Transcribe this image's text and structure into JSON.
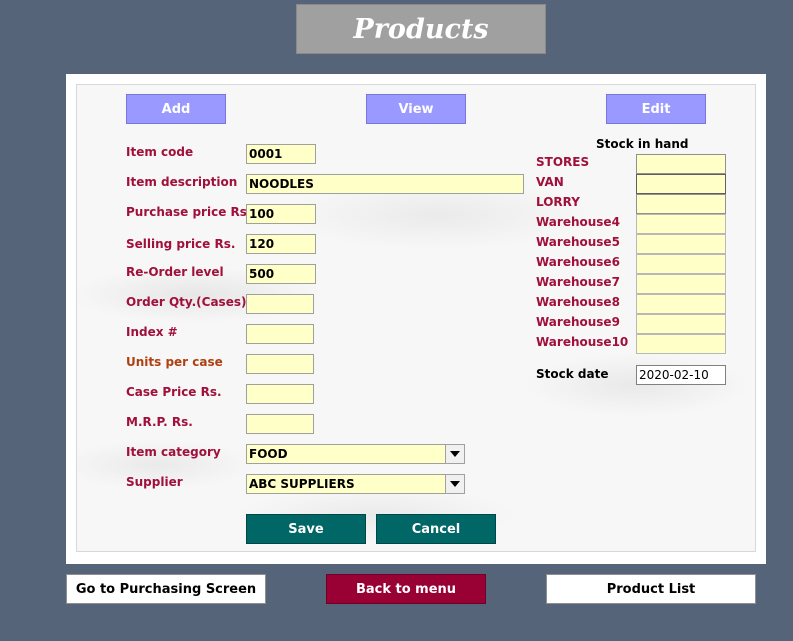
{
  "header": {
    "title": "Products"
  },
  "toolbar": {
    "add_label": "Add",
    "view_label": "View",
    "edit_label": "Edit"
  },
  "form": {
    "item_code_label": "Item code",
    "item_code": "0001",
    "item_description_label": "Item description",
    "item_description": "NOODLES",
    "purchase_price_label": "Purchase price Rs.",
    "purchase_price": "100",
    "selling_price_label": "Selling price Rs.",
    "selling_price": "120",
    "reorder_level_label": "Re-Order level",
    "reorder_level": "500",
    "order_qty_label": "Order Qty.(Cases)",
    "order_qty": "",
    "index_label": "Index #",
    "index": "",
    "units_per_case_label": "Units per case",
    "units_per_case": "",
    "case_price_label": "Case Price Rs.",
    "case_price": "",
    "mrp_label": "M.R.P. Rs.",
    "mrp": "",
    "item_category_label": "Item category",
    "item_category": "FOOD",
    "supplier_label": "Supplier",
    "supplier": "ABC SUPPLIERS",
    "save_label": "Save",
    "cancel_label": "Cancel"
  },
  "stock": {
    "heading": "Stock in hand",
    "locations": [
      "STORES",
      "VAN",
      "LORRY",
      "Warehouse4",
      "Warehouse5",
      "Warehouse6",
      "Warehouse7",
      "Warehouse8",
      "Warehouse9",
      "Warehouse10"
    ],
    "stock_date_label": "Stock  date",
    "stock_date": "2020-02-10"
  },
  "footer": {
    "purchasing_label": "Go to Purchasing Screen",
    "back_label": "Back to menu",
    "product_list_label": "Product List"
  },
  "colors": {
    "background": "#56647a",
    "label": "#a0103a",
    "field": "#ffffc8",
    "top_button": "#9999ff",
    "action_button": "#006666",
    "back_button": "#990033"
  }
}
